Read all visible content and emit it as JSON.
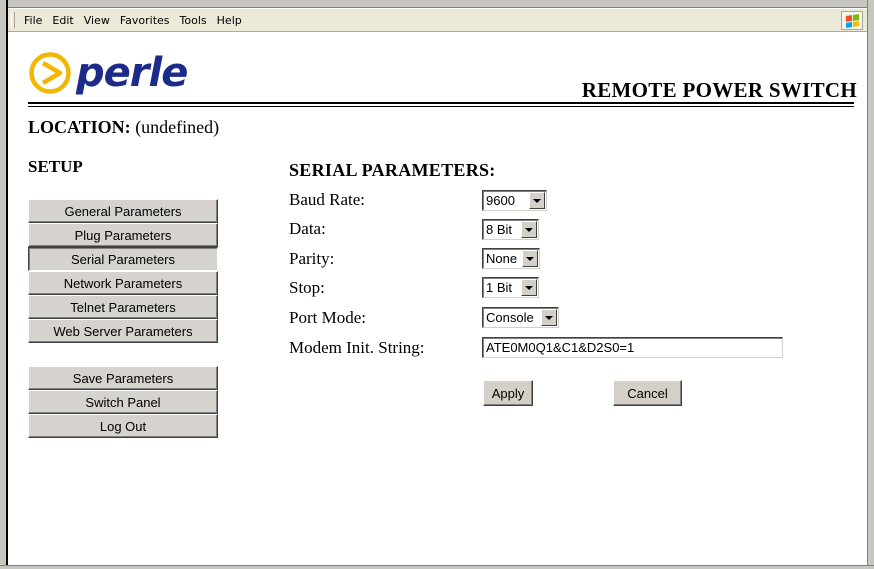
{
  "menu": {
    "items": [
      "File",
      "Edit",
      "View",
      "Favorites",
      "Tools",
      "Help"
    ]
  },
  "header": {
    "logo_text": "perle",
    "title": "REMOTE POWER SWITCH",
    "brand_color": "#1c2b8a",
    "logo_accent": "#f2b705"
  },
  "location": {
    "label": "LOCATION:",
    "value": "(undefined)"
  },
  "sidebar": {
    "heading": "SETUP",
    "items": [
      {
        "label": "General Parameters",
        "active": false
      },
      {
        "label": "Plug Parameters",
        "active": false
      },
      {
        "label": "Serial Parameters",
        "active": true
      },
      {
        "label": "Network Parameters",
        "active": false
      },
      {
        "label": "Telnet Parameters",
        "active": false
      },
      {
        "label": "Web Server Parameters",
        "active": false
      }
    ],
    "actions": [
      {
        "label": "Save Parameters"
      },
      {
        "label": "Switch Panel"
      },
      {
        "label": "Log Out"
      }
    ]
  },
  "form": {
    "heading": "SERIAL PARAMETERS:",
    "baud_rate": {
      "label": "Baud Rate:",
      "value": "9600"
    },
    "data": {
      "label": "Data:",
      "value": "8 Bit"
    },
    "parity": {
      "label": "Parity:",
      "value": "None"
    },
    "stop": {
      "label": "Stop:",
      "value": "1 Bit"
    },
    "port_mode": {
      "label": "Port Mode:",
      "value": "Console"
    },
    "modem_init": {
      "label": "Modem Init. String:",
      "value": "ATE0M0Q1&C1&D2S0=1"
    },
    "apply_label": "Apply",
    "cancel_label": "Cancel"
  }
}
